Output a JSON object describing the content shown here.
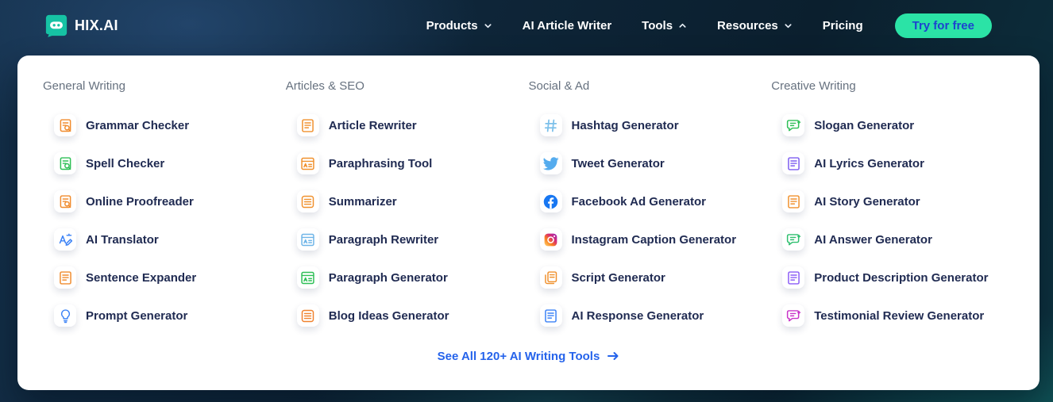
{
  "header": {
    "logo_text": "HIX.AI",
    "nav": [
      {
        "label": "Products",
        "chevron": "down"
      },
      {
        "label": "AI Article Writer",
        "chevron": null
      },
      {
        "label": "Tools",
        "chevron": "up"
      },
      {
        "label": "Resources",
        "chevron": "down"
      },
      {
        "label": "Pricing",
        "chevron": null
      }
    ],
    "cta": {
      "label": "Try for free",
      "bg": "#2be3a6",
      "text_color": "#1d43cf"
    }
  },
  "menu": {
    "columns": [
      {
        "title": "General Writing",
        "items": [
          {
            "label": "Grammar Checker",
            "icon": "grammar-checker-icon",
            "icon_color": "#f08c2e"
          },
          {
            "label": "Spell Checker",
            "icon": "spell-checker-icon",
            "icon_color": "#2fbf57"
          },
          {
            "label": "Online Proofreader",
            "icon": "online-proofreader-icon",
            "icon_color": "#f08c2e"
          },
          {
            "label": "AI Translator",
            "icon": "ai-translator-icon",
            "icon_color": "#3b82f6"
          },
          {
            "label": "Sentence Expander",
            "icon": "sentence-expander-icon",
            "icon_color": "#f08c2e"
          },
          {
            "label": "Prompt Generator",
            "icon": "prompt-generator-icon",
            "icon_color": "#3b82f6"
          }
        ]
      },
      {
        "title": "Articles & SEO",
        "items": [
          {
            "label": "Article Rewriter",
            "icon": "article-rewriter-icon",
            "icon_color": "#f0912e"
          },
          {
            "label": "Paraphrasing Tool",
            "icon": "paraphrasing-tool-icon",
            "icon_color": "#f0912e"
          },
          {
            "label": "Summarizer",
            "icon": "summarizer-icon",
            "icon_color": "#f0912e"
          },
          {
            "label": "Paragraph Rewriter",
            "icon": "paragraph-rewriter-icon",
            "icon_color": "#6fb5e8"
          },
          {
            "label": "Paragraph Generator",
            "icon": "paragraph-generator-icon",
            "icon_color": "#2fbf57"
          },
          {
            "label": "Blog Ideas Generator",
            "icon": "blog-ideas-generator-icon",
            "icon_color": "#f0822e"
          }
        ]
      },
      {
        "title": "Social & Ad",
        "items": [
          {
            "label": "Hashtag Generator",
            "icon": "hashtag-generator-icon",
            "icon_color": "#7cc0ea"
          },
          {
            "label": "Tweet Generator",
            "icon": "twitter-icon",
            "icon_color": "#55acee"
          },
          {
            "label": "Facebook Ad Generator",
            "icon": "facebook-icon",
            "icon_color": "#1877f2"
          },
          {
            "label": "Instagram Caption Generator",
            "icon": "instagram-icon",
            "icon_color": "#d62976"
          },
          {
            "label": "Script Generator",
            "icon": "script-generator-icon",
            "icon_color": "#f0912e"
          },
          {
            "label": "AI Response Generator",
            "icon": "ai-response-generator-icon",
            "icon_color": "#3b82f6"
          }
        ]
      },
      {
        "title": "Creative Writing",
        "items": [
          {
            "label": "Slogan Generator",
            "icon": "slogan-generator-icon",
            "icon_color": "#2fbf57"
          },
          {
            "label": "AI Lyrics Generator",
            "icon": "ai-lyrics-generator-icon",
            "icon_color": "#7c5cf0"
          },
          {
            "label": "AI Story Generator",
            "icon": "ai-story-generator-icon",
            "icon_color": "#f0912e"
          },
          {
            "label": "AI Answer Generator",
            "icon": "ai-answer-generator-icon",
            "icon_color": "#2fbf6f"
          },
          {
            "label": "Product Description Generator",
            "icon": "product-description-generator-icon",
            "icon_color": "#8b5cf6"
          },
          {
            "label": "Testimonial Review Generator",
            "icon": "testimonial-review-generator-icon",
            "icon_color": "#c935c9"
          }
        ]
      }
    ],
    "see_all": {
      "label": "See All 120+ AI Writing Tools",
      "color": "#2563eb"
    }
  },
  "colors": {
    "cta_bg": "#2be3a6",
    "cta_text": "#1d43cf",
    "link_blue": "#2563eb",
    "item_text": "#202b52",
    "column_title": "#66717f",
    "header_bg": "#0e2538"
  }
}
